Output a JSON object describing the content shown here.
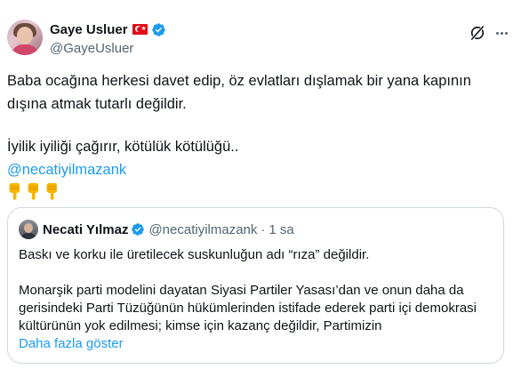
{
  "author": {
    "name": "Gaye Usluer",
    "handle": "@GayeUsluer",
    "flag": "turkey-flag-icon",
    "verified": true
  },
  "tweet": {
    "paragraph1": "Baba ocağına herkesi davet edip, öz evlatları dışlamak bir yana kapının dışına atmak tutarlı değildir.",
    "paragraph2": "İyilik iyiliği çağırır, kötülük kötülüğü..",
    "mention": "@necatiyilmazank",
    "emojis": [
      "pointing-down-hand-icon",
      "pointing-down-hand-icon",
      "pointing-down-hand-icon"
    ]
  },
  "quoted": {
    "name": "Necati Yılmaz",
    "handle": "@necatiyilmazank",
    "separator": "·",
    "time": "1 sa",
    "verified": true,
    "paragraph1": "Baskı ve korku ile üretilecek suskunluğun adı “rıza” değildir.",
    "paragraph2": "Monarşik parti modelini dayatan Siyasi Partiler Yasası’dan ve onun daha da gerisindeki Parti Tüzüğünün hükümlerinden istifade ederek parti içi demokrasi kültürünün yok edilmesi; kimse için kazanç değildir, Partimizin",
    "show_more": "Daha fazla göster"
  },
  "colors": {
    "accent": "#1d9bf0",
    "secondary_text": "#536471",
    "border": "#cfd9de"
  }
}
